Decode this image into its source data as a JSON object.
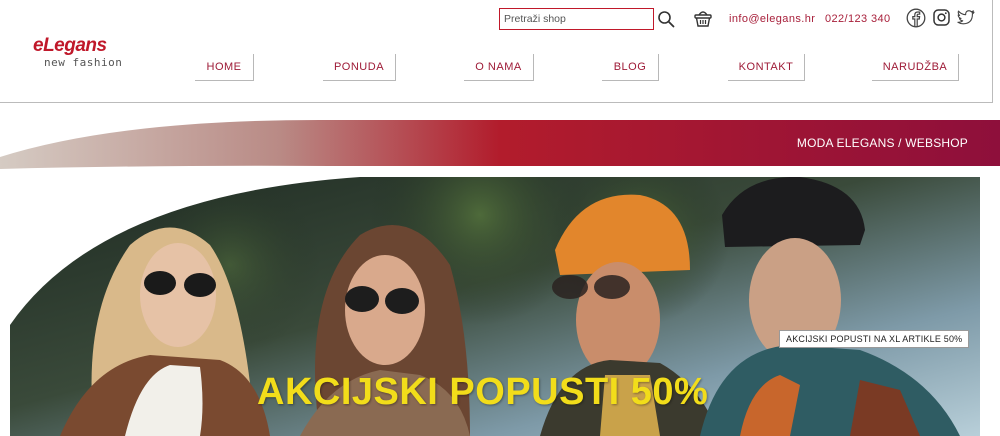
{
  "logo": {
    "main": "eLegans",
    "sub": "new fashion"
  },
  "search": {
    "placeholder": "Pretraži shop",
    "value": ""
  },
  "contact": {
    "email": "info@elegans.hr",
    "phone": "022/123 340"
  },
  "icons": {
    "search": "search-icon",
    "basket": "basket-icon",
    "facebook": "facebook-icon",
    "instagram": "instagram-icon",
    "twitter": "twitter-icon"
  },
  "nav": {
    "items": [
      {
        "label": "HOME"
      },
      {
        "label": "PONUDA"
      },
      {
        "label": "O NAMA"
      },
      {
        "label": "BLOG"
      },
      {
        "label": "KONTAKT"
      },
      {
        "label": "NARUDŽBA"
      }
    ]
  },
  "banner": {
    "text": "MODA ELEGANS / WEBSHOP"
  },
  "hero": {
    "badge": "AKCIJSKI POPUSTI NA XL ARTIKLE 50%",
    "title": "AKCIJSKI POPUSTI 50%"
  },
  "colors": {
    "brand": "#c0182a",
    "accent_text": "#a8203b",
    "banner_start": "#cdbfb3",
    "banner_mid": "#b3182d",
    "banner_end": "#8e0f3b",
    "hero_title": "#f2dd1a"
  }
}
